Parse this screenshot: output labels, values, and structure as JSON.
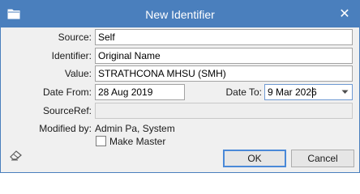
{
  "window": {
    "title": "New Identifier",
    "title_icon": "folder-icon",
    "close_glyph": "✕"
  },
  "form": {
    "source": {
      "label": "Source:",
      "value": "Self"
    },
    "identifier": {
      "label": "Identifier:",
      "value": "Original Name"
    },
    "value": {
      "label": "Value:",
      "value": "STRATHCONA MHSU (SMH)"
    },
    "date_from": {
      "label": "Date From:",
      "value": "28 Aug 2019"
    },
    "date_to": {
      "label": "Date To:",
      "value": "9 Mar 2026"
    },
    "source_ref": {
      "label": "SourceRef:",
      "value": ""
    },
    "modified_by": {
      "label": "Modified by:",
      "value": "Admin Pa, System"
    },
    "make_master": {
      "label": "Make Master",
      "checked": false
    }
  },
  "buttons": {
    "ok": "OK",
    "cancel": "Cancel"
  },
  "colors": {
    "titlebar": "#4a7fbd",
    "client_bg": "#f0f0f0",
    "default_button_border": "#4a89d8"
  }
}
